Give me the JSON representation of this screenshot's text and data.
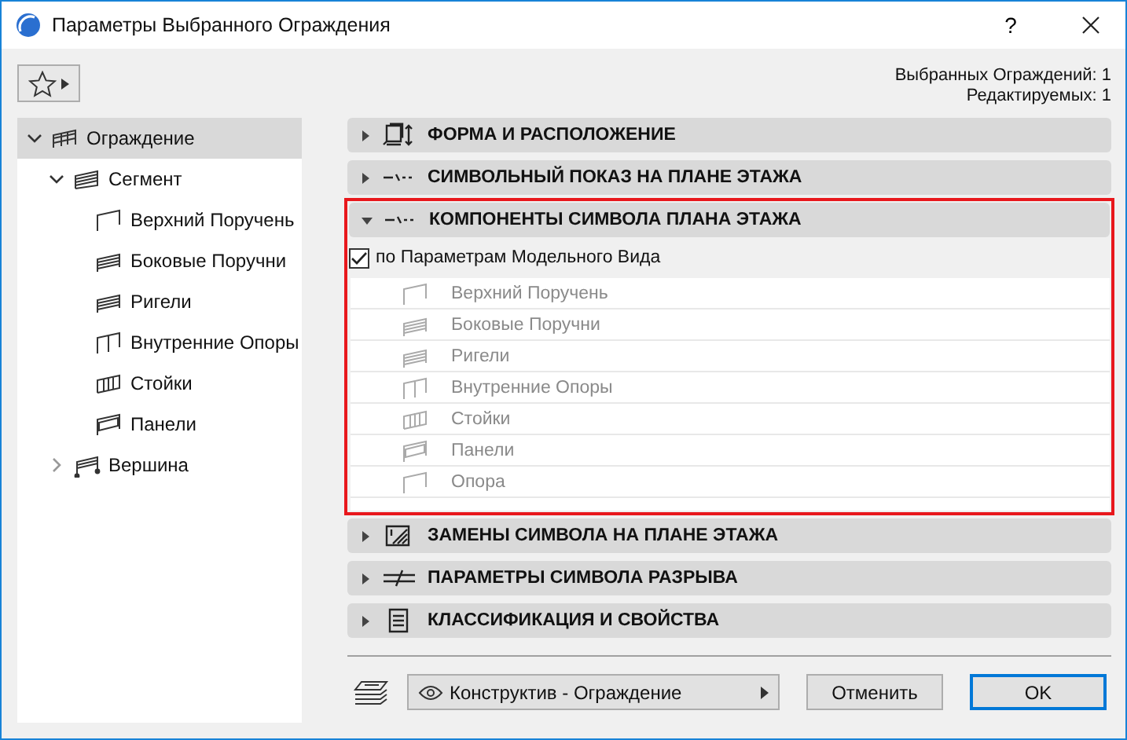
{
  "window": {
    "title": "Параметры Выбранного Ограждения",
    "help": "?"
  },
  "counts": [
    "Выбранных Ограждений: 1",
    "Редактируемых: 1"
  ],
  "tree": [
    {
      "label": "Ограждение",
      "kind": "railing",
      "expanded": true,
      "selected": true,
      "children": [
        {
          "label": "Сегмент",
          "kind": "segment",
          "expanded": true,
          "selected": false,
          "children": [
            {
              "label": "Верхний Поручень",
              "kind": "top-rail",
              "selected": false
            },
            {
              "label": "Боковые Поручни",
              "kind": "rails",
              "selected": false
            },
            {
              "label": "Ригели",
              "kind": "rails",
              "selected": false
            },
            {
              "label": "Внутренние Опоры",
              "kind": "post",
              "selected": false
            },
            {
              "label": "Стойки",
              "kind": "balusters",
              "selected": false
            },
            {
              "label": "Панели",
              "kind": "panel",
              "selected": false
            }
          ]
        },
        {
          "label": "Вершина",
          "kind": "node",
          "expanded": false,
          "selected": false
        }
      ]
    }
  ],
  "sections": [
    {
      "title": "ФОРМА И РАСПОЛОЖЕНИЕ",
      "kind": "shape",
      "expanded": false,
      "highlighted": false
    },
    {
      "title": "СИМВОЛЬНЫЙ ПОКАЗ НА ПЛАНЕ ЭТАЖА",
      "kind": "symbol",
      "expanded": false,
      "highlighted": false
    },
    {
      "title": "КОМПОНЕНТЫ СИМВОЛА ПЛАНА ЭТАЖА",
      "kind": "symbol",
      "expanded": true,
      "highlighted": true,
      "checkbox": {
        "label": "по Параметрам Модельного Вида",
        "checked": true
      },
      "components": [
        {
          "label": "Верхний Поручень",
          "kind": "top-rail",
          "disabled": true
        },
        {
          "label": "Боковые Поручни",
          "kind": "rails",
          "disabled": true
        },
        {
          "label": "Ригели",
          "kind": "rails",
          "disabled": true
        },
        {
          "label": "Внутренние Опоры",
          "kind": "post",
          "disabled": true
        },
        {
          "label": "Стойки",
          "kind": "balusters",
          "disabled": true
        },
        {
          "label": "Панели",
          "kind": "panel",
          "disabled": true
        },
        {
          "label": "Опора",
          "kind": "top-rail",
          "disabled": true
        }
      ]
    },
    {
      "title": "ЗАМЕНЫ СИМВОЛА НА ПЛАНЕ ЭТАЖА",
      "kind": "override",
      "expanded": false,
      "highlighted": false
    },
    {
      "title": "ПАРАМЕТРЫ СИМВОЛА РАЗРЫВА",
      "kind": "break",
      "expanded": false,
      "highlighted": false
    },
    {
      "title": "КЛАССИФИКАЦИЯ И СВОЙСТВА",
      "kind": "properties",
      "expanded": false,
      "highlighted": false
    }
  ],
  "footer": {
    "view": "Конструктив - Ограждение",
    "buttons": [
      {
        "label": "Отменить",
        "default": false
      },
      {
        "label": "OK",
        "default": true
      }
    ]
  }
}
